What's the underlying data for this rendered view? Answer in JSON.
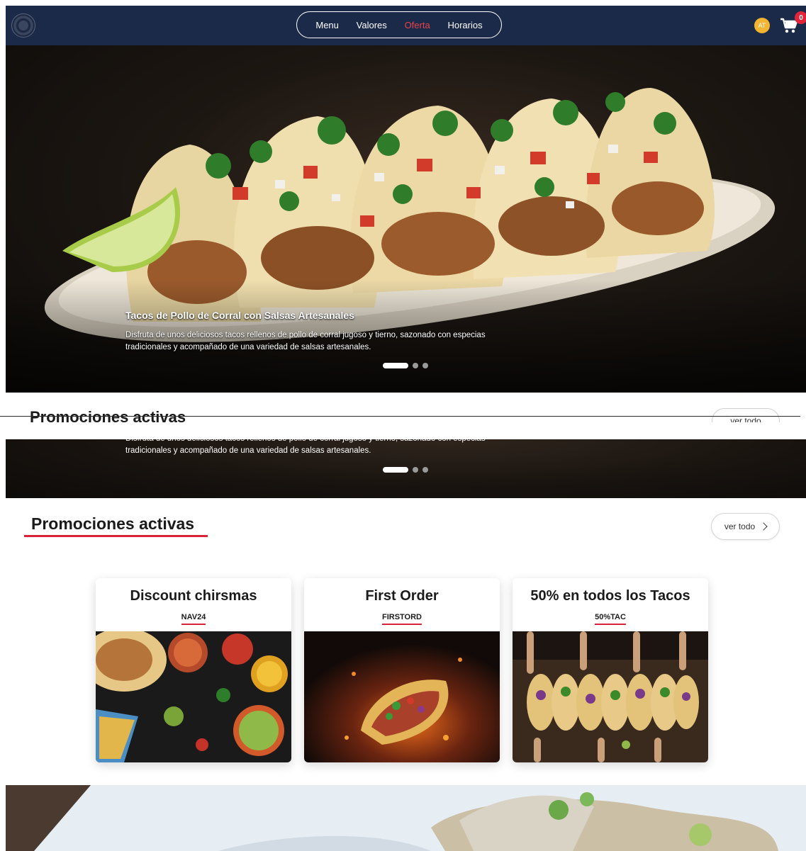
{
  "nav": {
    "items": [
      {
        "label": "Menu",
        "active": false
      },
      {
        "label": "Valores",
        "active": false
      },
      {
        "label": "Oferta",
        "active": true
      },
      {
        "label": "Horarios",
        "active": false
      }
    ],
    "avatar_initials": "AT",
    "cart_count": "0"
  },
  "hero": {
    "title": "Tacos de Pollo de Corral con Salsas Artesanales",
    "description": "Disfruta de unos deliciosos tacos rellenos de pollo de corral jugoso y tierno, sazonado con especias tradicionales y acompañado de una variedad de salsas artesanales.",
    "slides": 3,
    "active_slide": 1
  },
  "promotions": {
    "heading": "Promociones activas",
    "see_all_label": "ver todo",
    "peek_heading": "Promociones activas",
    "peek_see_all_label": "ver todo",
    "cards": [
      {
        "title": "Discount chirsmas",
        "code": "NAV24"
      },
      {
        "title": "First Order",
        "code": "FIRSTORD"
      },
      {
        "title": "50% en todos los Tacos",
        "code": "50%TAC"
      }
    ]
  },
  "colors": {
    "navbar": "#1c2a4a",
    "accent_red": "#d9233b",
    "active_nav": "#e8434a",
    "avatar": "#f2b431"
  }
}
